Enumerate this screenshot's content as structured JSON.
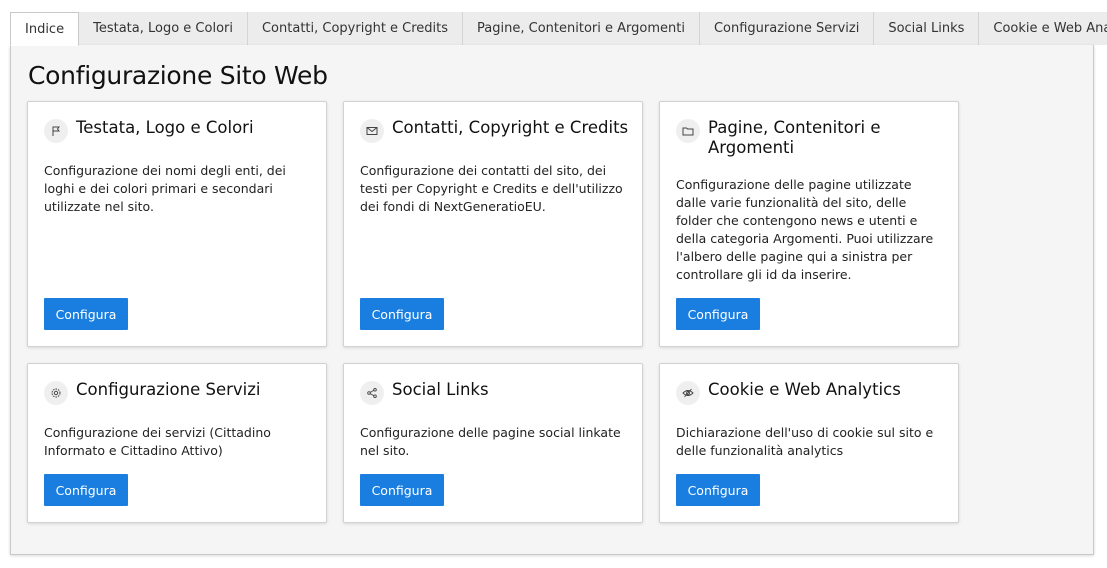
{
  "tabs": [
    {
      "label": "Indice",
      "active": true
    },
    {
      "label": "Testata, Logo e Colori",
      "active": false
    },
    {
      "label": "Contatti, Copyright e Credits",
      "active": false
    },
    {
      "label": "Pagine, Contenitori e Argomenti",
      "active": false
    },
    {
      "label": "Configurazione Servizi",
      "active": false
    },
    {
      "label": "Social Links",
      "active": false
    },
    {
      "label": "Cookie e Web Analytics",
      "active": false
    }
  ],
  "page": {
    "title": "Configurazione Sito Web"
  },
  "cards": [
    {
      "icon": "flag-icon",
      "title": "Testata, Logo e Colori",
      "description": "Configurazione dei nomi degli enti, dei loghi e dei colori primari e secondari utilizzate nel sito.",
      "button": "Configura"
    },
    {
      "icon": "envelope-icon",
      "title": "Contatti, Copyright e Credits",
      "description": "Configurazione dei contatti del sito, dei testi per Copyright e Credits e dell'utilizzo dei fondi di NextGeneratioEU.",
      "button": "Configura"
    },
    {
      "icon": "folder-icon",
      "title": "Pagine, Contenitori e Argomenti",
      "description": "Configurazione delle pagine utilizzate dalle varie funzionalità del sito, delle folder che contengono news e utenti e della categoria Argomenti. Puoi utilizzare l'albero delle pagine qui a sinistra per controllare gli id da inserire.",
      "button": "Configura"
    },
    {
      "icon": "gear-icon",
      "title": "Configurazione Servizi",
      "description": "Configurazione dei servizi (Cittadino Informato e Cittadino Attivo)",
      "button": "Configura"
    },
    {
      "icon": "share-icon",
      "title": "Social Links",
      "description": "Configurazione delle pagine social linkate nel sito.",
      "button": "Configura"
    },
    {
      "icon": "eye-slash-icon",
      "title": "Cookie e Web Analytics",
      "description": "Dichiarazione dell'uso di cookie sul sito e delle funzionalità analytics",
      "button": "Configura"
    }
  ],
  "colors": {
    "accent": "#1a7ee0",
    "panel_bg": "#f5f5f5",
    "tab_bg": "#ececec"
  }
}
